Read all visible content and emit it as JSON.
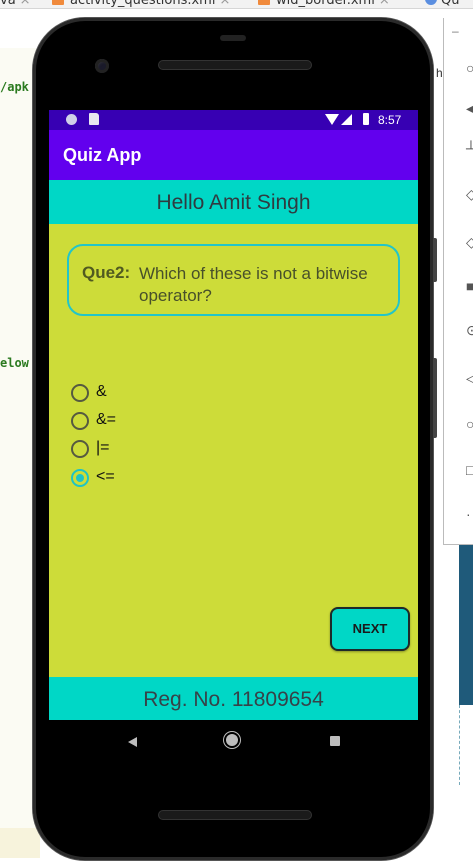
{
  "ide": {
    "tabs": [
      {
        "label": "va"
      },
      {
        "label": "activity_questions.xml"
      },
      {
        "label": "wid_border.xml"
      },
      {
        "label": "Qu"
      }
    ],
    "code_snippets": [
      "/apk",
      "elow"
    ],
    "side_text": "h"
  },
  "device": {
    "status_time": "8:57"
  },
  "app": {
    "title": "Quiz App",
    "greeting": "Hello Amit Singh",
    "question": {
      "number": "Que2:",
      "text": "Which of these is not a bitwise operator?"
    },
    "options": [
      {
        "label": "&",
        "selected": false
      },
      {
        "label": "&=",
        "selected": false
      },
      {
        "label": "|=",
        "selected": false
      },
      {
        "label": "<=",
        "selected": true
      }
    ],
    "next_label": "NEXT",
    "footer": "Reg. No. 11809654"
  },
  "colors": {
    "status_bar": "#3700b3",
    "app_bar": "#6200ee",
    "accent_teal": "#00d7c6",
    "screen_background": "#cddc39"
  }
}
